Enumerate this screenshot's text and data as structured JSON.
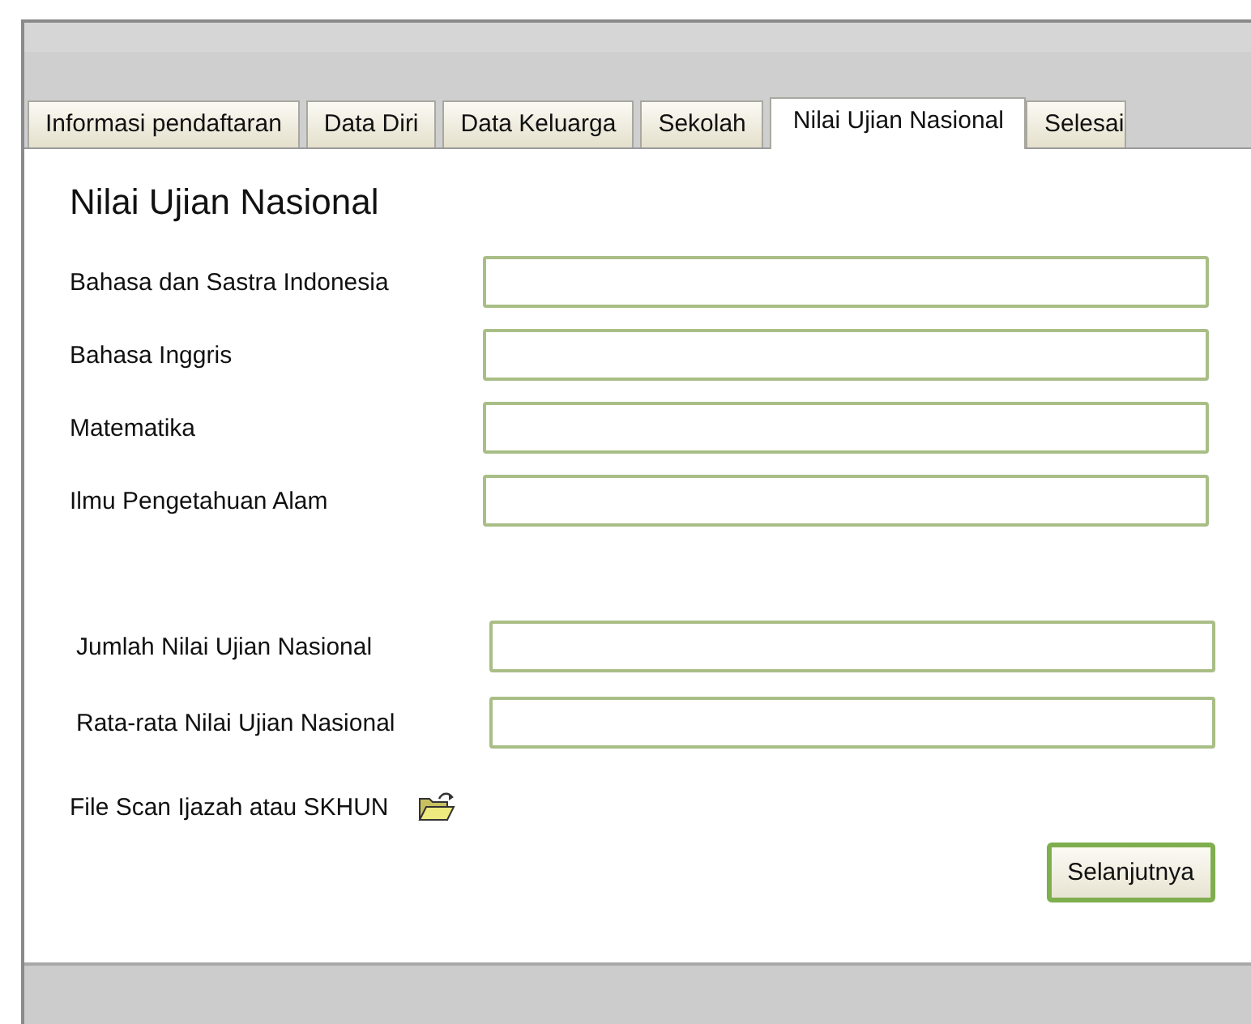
{
  "tabs": [
    {
      "label": "Informasi pendaftaran",
      "selected": false
    },
    {
      "label": "Data Diri",
      "selected": false
    },
    {
      "label": "Data Keluarga",
      "selected": false
    },
    {
      "label": "Sekolah",
      "selected": false
    },
    {
      "label": "Nilai Ujian Nasional",
      "selected": true
    },
    {
      "label": "Selesai",
      "selected": false
    }
  ],
  "title": "Nilai Ujian Nasional",
  "sections": [
    {
      "fields": [
        {
          "label": "Bahasa dan Sastra Indonesia"
        },
        {
          "label": "Bahasa Inggris"
        },
        {
          "label": "Matematika"
        },
        {
          "label": "Ilmu Pengetahuan Alam"
        }
      ]
    },
    {
      "fields": [
        {
          "label": "Jumlah Nilai Ujian Nasional"
        },
        {
          "label": "Rata-rata Nilai Ujian Nasional"
        }
      ]
    }
  ],
  "file_row": {
    "label": "File Scan Ijazah atau SKHUN"
  },
  "buttons": [
    {
      "label": "Selanjutnya"
    }
  ]
}
